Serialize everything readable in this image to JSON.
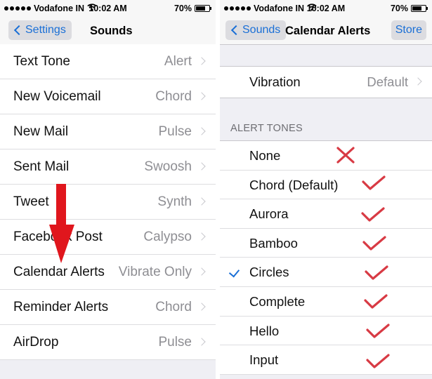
{
  "status_bar": {
    "carrier": "Vodafone IN",
    "time": "10:02 AM",
    "battery": "70%",
    "battery_level": 0.7
  },
  "left": {
    "nav": {
      "back_label": "Settings",
      "title": "Sounds"
    },
    "rows": [
      {
        "label": "Text Tone",
        "value": "Alert"
      },
      {
        "label": "New Voicemail",
        "value": "Chord"
      },
      {
        "label": "New Mail",
        "value": "Pulse"
      },
      {
        "label": "Sent Mail",
        "value": "Swoosh"
      },
      {
        "label": "Tweet",
        "value": "Synth"
      },
      {
        "label": "Facebook Post",
        "value": "Calypso"
      },
      {
        "label": "Calendar Alerts",
        "value": "Vibrate Only"
      },
      {
        "label": "Reminder Alerts",
        "value": "Chord"
      },
      {
        "label": "AirDrop",
        "value": "Pulse"
      }
    ]
  },
  "right": {
    "nav": {
      "back_label": "Sounds",
      "title": "Calendar Alerts",
      "store_label": "Store"
    },
    "vibration": {
      "label": "Vibration",
      "value": "Default"
    },
    "section_header": "ALERT TONES",
    "tones": [
      {
        "label": "None",
        "selected": false,
        "annotation": "cross"
      },
      {
        "label": "Chord (Default)",
        "selected": false,
        "annotation": "check"
      },
      {
        "label": "Aurora",
        "selected": false,
        "annotation": "check"
      },
      {
        "label": "Bamboo",
        "selected": false,
        "annotation": "check"
      },
      {
        "label": "Circles",
        "selected": true,
        "annotation": "check"
      },
      {
        "label": "Complete",
        "selected": false,
        "annotation": "check"
      },
      {
        "label": "Hello",
        "selected": false,
        "annotation": "check"
      },
      {
        "label": "Input",
        "selected": false,
        "annotation": "check"
      }
    ]
  },
  "colors": {
    "ios_blue": "#1a6fd6",
    "annotation_red": "#d83a44",
    "arrow_red": "#e0161d",
    "secondary_text": "#8e8e93"
  }
}
